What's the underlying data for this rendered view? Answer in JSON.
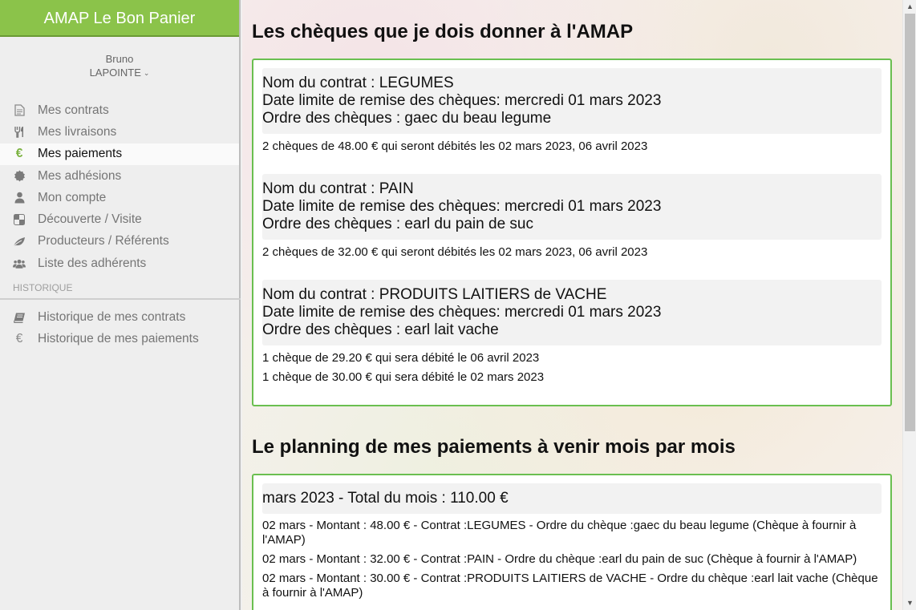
{
  "app": {
    "title": "AMAP Le Bon Panier"
  },
  "user": {
    "first_name": "Bruno",
    "last_name": "LAPOINTE"
  },
  "nav": [
    {
      "label": "Mes contrats",
      "icon": "file-icon"
    },
    {
      "label": "Mes livraisons",
      "icon": "cutlery-icon"
    },
    {
      "label": "Mes paiements",
      "icon": "euro-icon",
      "active": true
    },
    {
      "label": "Mes adhésions",
      "icon": "badge-icon"
    },
    {
      "label": "Mon compte",
      "icon": "user-icon"
    },
    {
      "label": "Découverte / Visite",
      "icon": "checker-icon"
    },
    {
      "label": "Producteurs / Référents",
      "icon": "leaf-icon"
    },
    {
      "label": "Liste des adhérents",
      "icon": "users-icon"
    }
  ],
  "history": {
    "label": "HISTORIQUE",
    "items": [
      {
        "label": "Historique de mes contrats",
        "icon": "book-icon"
      },
      {
        "label": "Historique de mes paiements",
        "icon": "euro-icon"
      }
    ]
  },
  "cheques": {
    "title": "Les chèques que je dois donner à l'AMAP",
    "contracts": [
      {
        "name": "Nom du contrat : LEGUMES",
        "deadline": "Date limite de remise des chèques: mercredi 01 mars 2023",
        "order": "Ordre des chèques : gaec du beau legume",
        "lines": [
          "2 chèques de 48.00 € qui seront débités les 02 mars 2023, 06 avril 2023"
        ]
      },
      {
        "name": "Nom du contrat : PAIN",
        "deadline": "Date limite de remise des chèques: mercredi 01 mars 2023",
        "order": "Ordre des chèques : earl du pain de suc",
        "lines": [
          "2 chèques de 32.00 € qui seront débités les 02 mars 2023, 06 avril 2023"
        ]
      },
      {
        "name": "Nom du contrat : PRODUITS LAITIERS de VACHE",
        "deadline": "Date limite de remise des chèques: mercredi 01 mars 2023",
        "order": "Ordre des chèques : earl lait vache",
        "lines": [
          "1 chèque de 29.20 € qui sera débité le 06 avril 2023",
          "1 chèque de 30.00 € qui sera débité le 02 mars 2023"
        ]
      }
    ]
  },
  "planning": {
    "title": "Le planning de mes paiements à venir mois par mois",
    "months": [
      {
        "header": "mars 2023 - Total du mois : 110.00 €",
        "lines": [
          "02 mars - Montant : 48.00 € - Contrat :LEGUMES - Ordre du chèque :gaec du beau legume (Chèque à fournir à l'AMAP)",
          "02 mars - Montant : 32.00 € - Contrat :PAIN - Ordre du chèque :earl du pain de suc (Chèque à fournir à l'AMAP)",
          "02 mars - Montant : 30.00 € - Contrat :PRODUITS LAITIERS de VACHE - Ordre du chèque :earl lait vache (Chèque à fournir à l'AMAP)"
        ]
      }
    ]
  },
  "colors": {
    "brand": "#8bc34a",
    "card_border": "#6abf50",
    "active_icon": "#7cb342"
  }
}
